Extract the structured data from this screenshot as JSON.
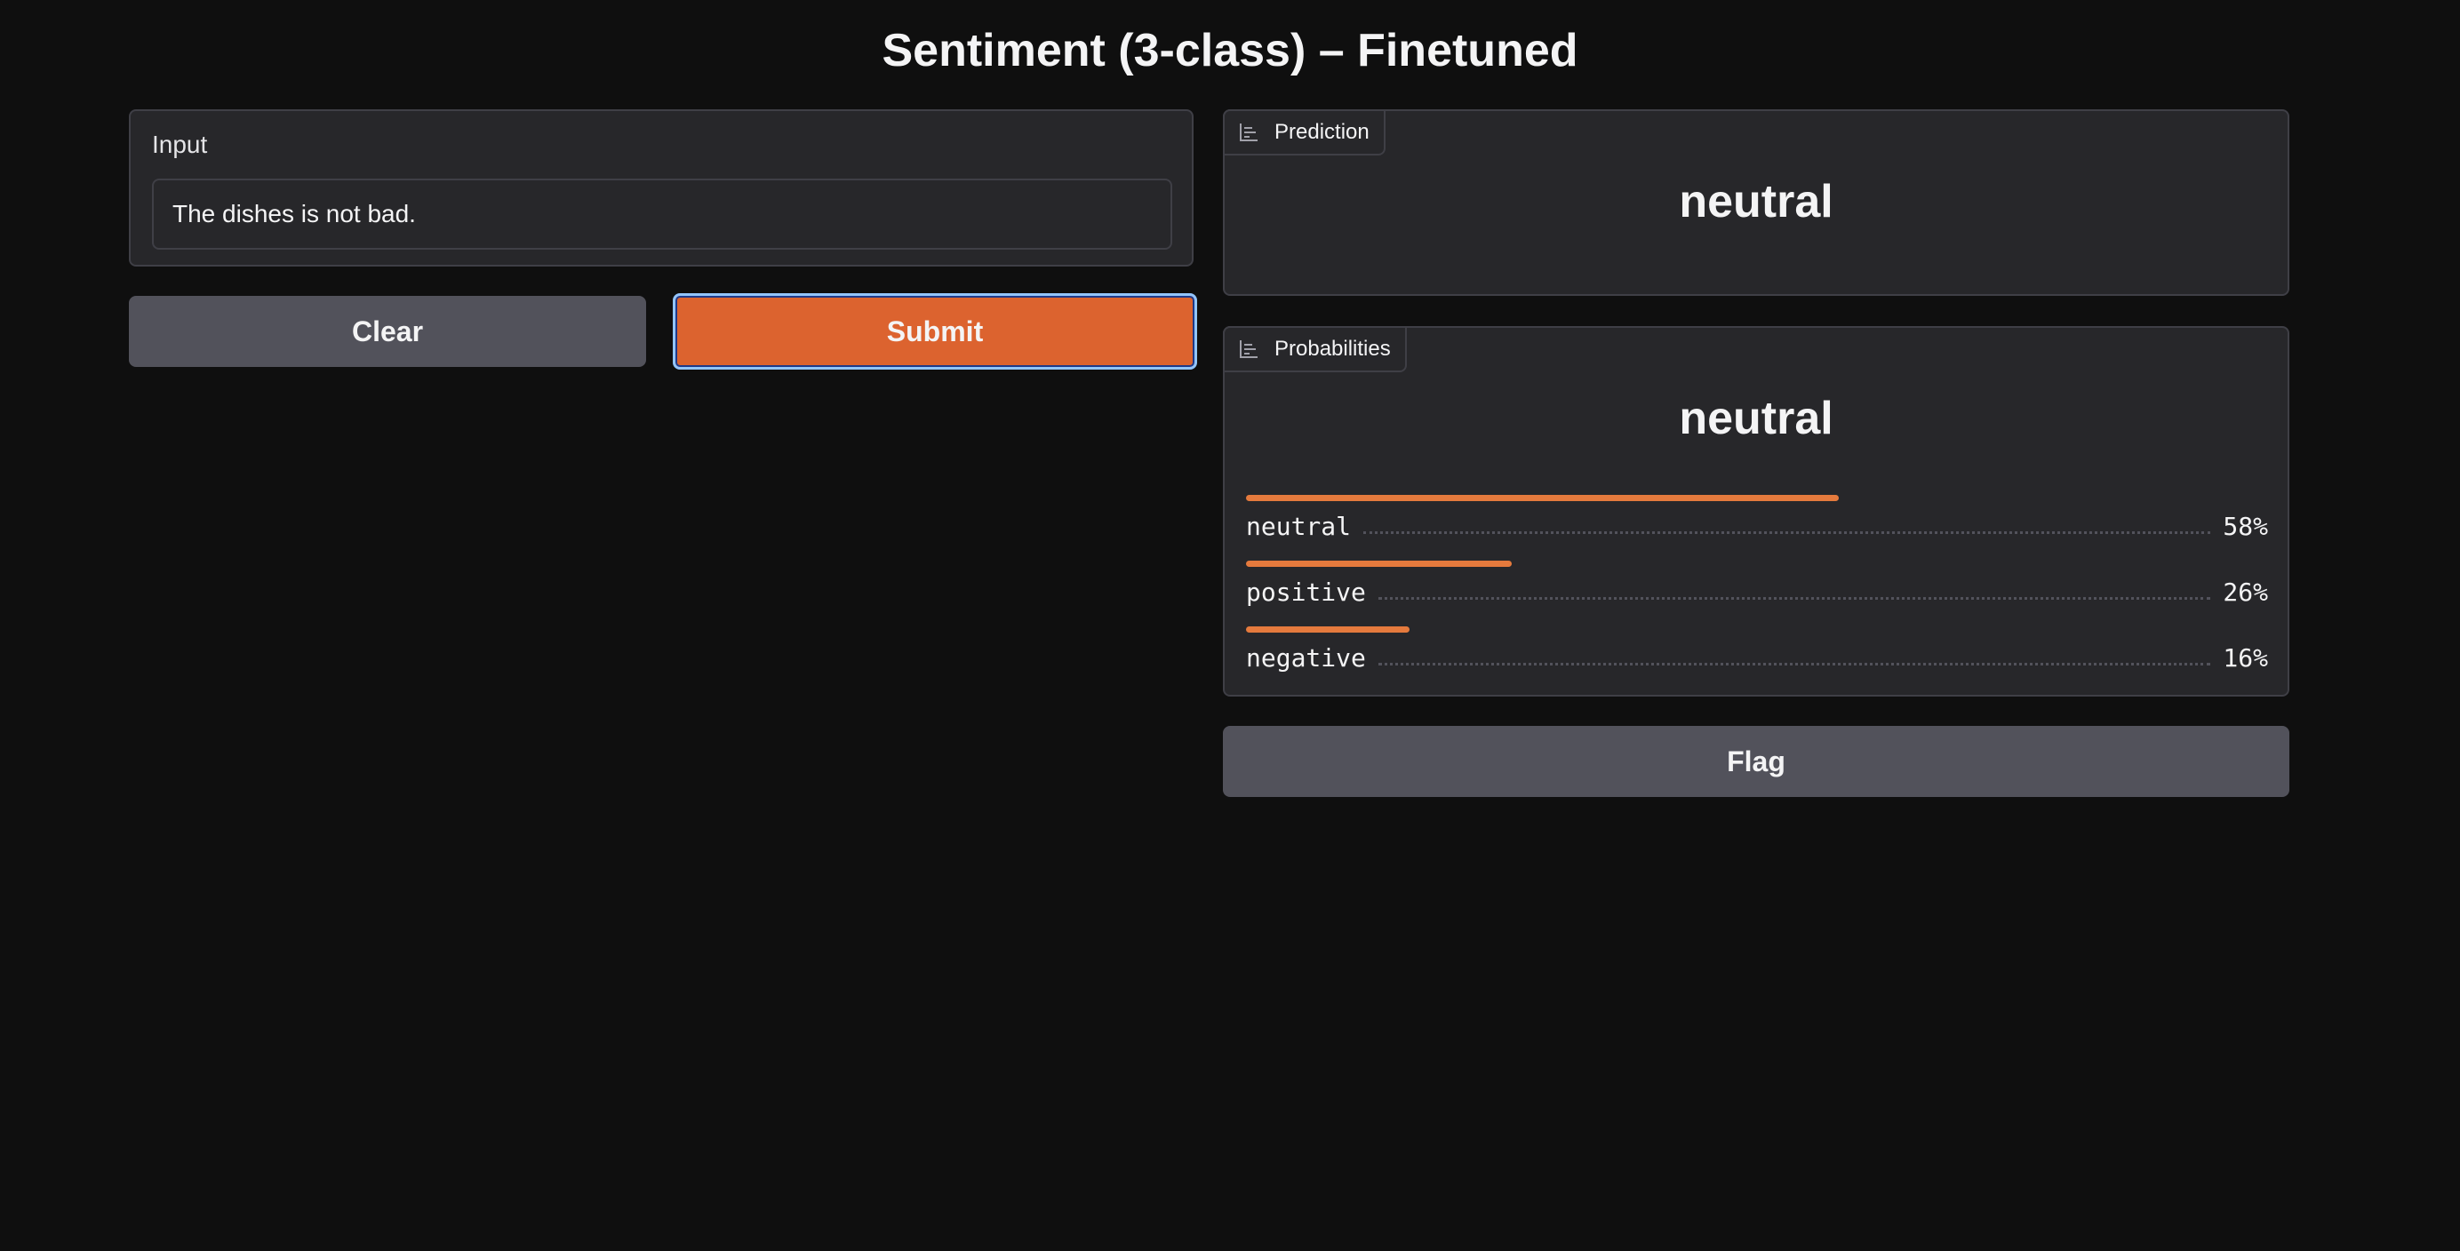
{
  "page": {
    "title": "Sentiment (3-class) – Finetuned"
  },
  "input": {
    "label": "Input",
    "value": "The dishes is not bad."
  },
  "buttons": {
    "clear": "Clear",
    "submit": "Submit",
    "flag": "Flag"
  },
  "prediction": {
    "tab_label": "Prediction",
    "tab_icon": "bar-chart-icon",
    "value": "neutral"
  },
  "probabilities": {
    "tab_label": "Probabilities",
    "tab_icon": "bar-chart-icon",
    "top_label": "neutral",
    "items": [
      {
        "name": "neutral",
        "percent_text": "58%",
        "value": 0.58
      },
      {
        "name": "positive",
        "percent_text": "26%",
        "value": 0.26
      },
      {
        "name": "negative",
        "percent_text": "16%",
        "value": 0.16
      }
    ]
  },
  "colors": {
    "background": "#0f0f0f",
    "panel": "#27272a",
    "accent": "#dc632f",
    "bar": "#e57a3d",
    "secondary_button": "#52525b"
  }
}
